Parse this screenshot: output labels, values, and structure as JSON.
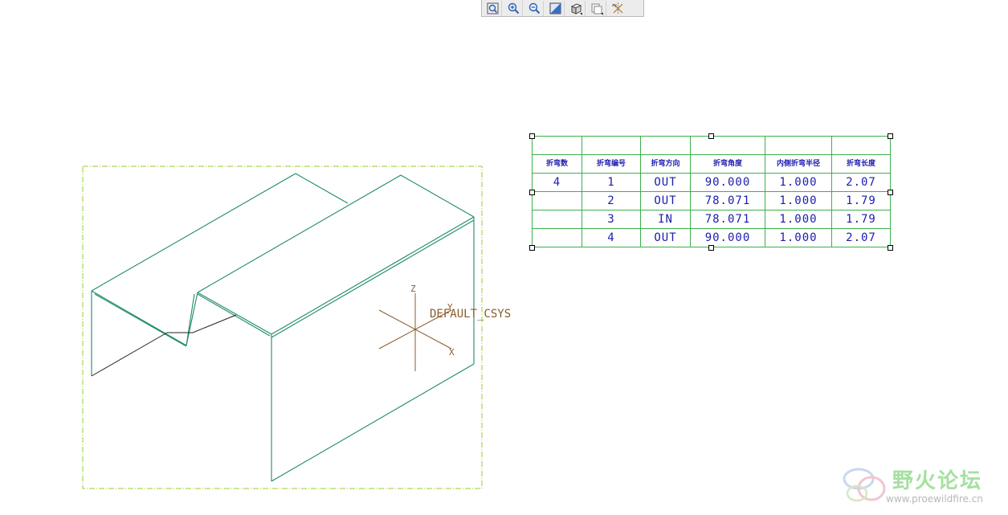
{
  "toolbar": {
    "buttons": [
      {
        "name": "refit",
        "icon": "zoom-fit-icon"
      },
      {
        "name": "zoom-in",
        "icon": "zoom-in-icon"
      },
      {
        "name": "zoom-out",
        "icon": "zoom-out-icon"
      },
      {
        "name": "repaint",
        "icon": "repaint-icon"
      },
      {
        "name": "display-style",
        "icon": "display-style-icon"
      },
      {
        "name": "saved-views",
        "icon": "saved-views-icon"
      },
      {
        "name": "datum-display",
        "icon": "datum-display-icon"
      }
    ]
  },
  "model": {
    "csys_label": "DEFAULT_CSYS",
    "axis_z": "Z",
    "axis_y": "Y",
    "axis_x": "X",
    "colors": {
      "edge": "#1f8a6c",
      "hidden_edge": "#222222",
      "frame": "#9acd32",
      "csys": "#8a5a2b"
    }
  },
  "bend_table": {
    "headers": [
      "折弯数",
      "折弯编号",
      "折弯方向",
      "折弯角度",
      "内侧折弯半径",
      "折弯长度"
    ],
    "rows": [
      [
        "4",
        "1",
        "OUT",
        "90.000",
        "1.000",
        "2.07"
      ],
      [
        "",
        "2",
        "OUT",
        "78.071",
        "1.000",
        "1.79"
      ],
      [
        "",
        "3",
        "IN",
        "78.071",
        "1.000",
        "1.79"
      ],
      [
        "",
        "4",
        "OUT",
        "90.000",
        "1.000",
        "2.07"
      ]
    ],
    "colors": {
      "grid": "#3cb14a",
      "text": "#1c1cb0"
    }
  },
  "watermark": {
    "title": "野火论坛",
    "url": "www.proewildfire.cn"
  }
}
